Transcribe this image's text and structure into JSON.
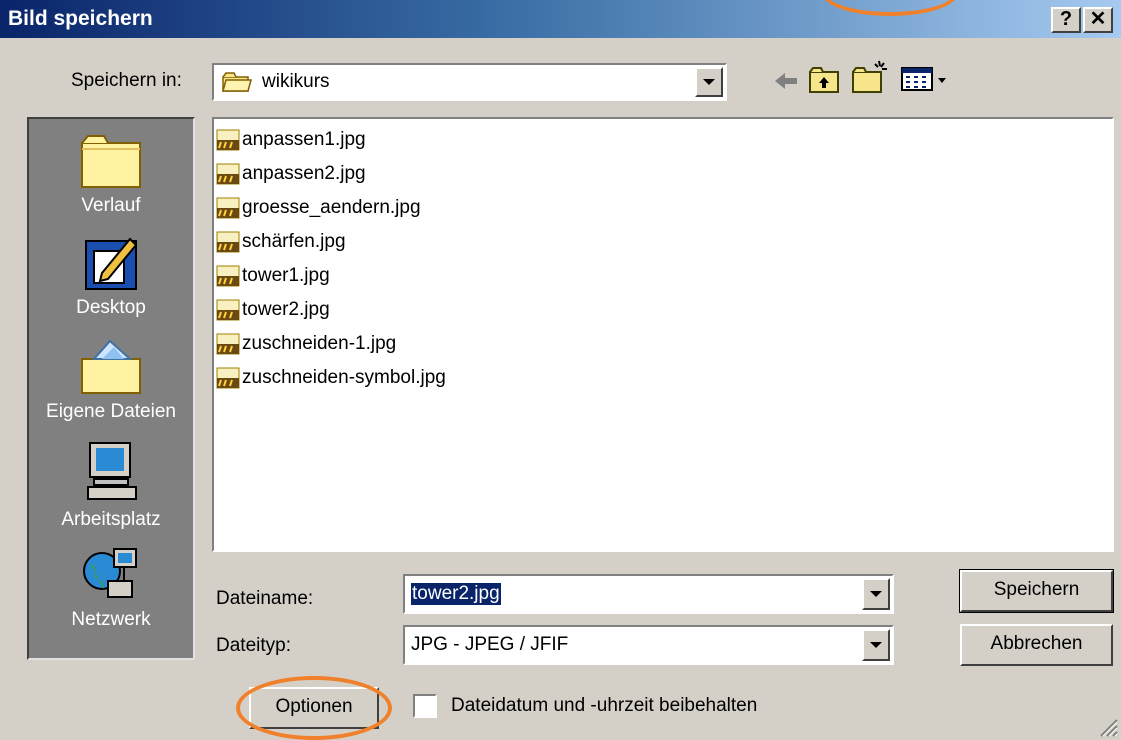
{
  "window": {
    "title": "Bild speichern",
    "help_label": "?",
    "close_label": "✕"
  },
  "location": {
    "label": "Speichern in:",
    "current_folder": "wikikurs"
  },
  "toolbar": {
    "icons": [
      "back-arrow-icon",
      "up-folder-icon",
      "new-folder-icon",
      "view-menu-icon"
    ]
  },
  "places": [
    {
      "label": "Verlauf",
      "icon": "history-folder-icon"
    },
    {
      "label": "Desktop",
      "icon": "desktop-icon"
    },
    {
      "label": "Eigene Dateien",
      "icon": "my-documents-icon"
    },
    {
      "label": "Arbeitsplatz",
      "icon": "my-computer-icon"
    },
    {
      "label": "Netzwerk",
      "icon": "network-icon"
    }
  ],
  "files": [
    "anpassen1.jpg",
    "anpassen2.jpg",
    "groesse_aendern.jpg",
    "schärfen.jpg",
    "tower1.jpg",
    "tower2.jpg",
    "zuschneiden-1.jpg",
    "zuschneiden-symbol.jpg"
  ],
  "filename": {
    "label": "Dateiname:",
    "value": "tower2.jpg"
  },
  "filetype": {
    "label": "Dateityp:",
    "value": "JPG - JPEG / JFIF"
  },
  "buttons": {
    "save": "Speichern",
    "cancel": "Abbrechen",
    "options": "Optionen"
  },
  "keep_date": {
    "label": "Dateidatum und -uhrzeit beibehalten",
    "checked": false
  },
  "colors": {
    "titlebar": "#0a246a",
    "highlight": "#f0812a",
    "selection": "#0a246a",
    "face": "#d4d0c8"
  }
}
